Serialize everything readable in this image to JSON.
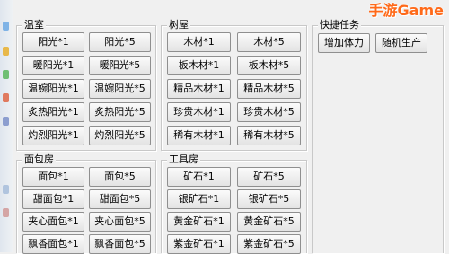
{
  "watermark": "手游Game",
  "groups": {
    "greenhouse": {
      "title": "温室",
      "buttons": [
        "阳光*1",
        "阳光*5",
        "暖阳光*1",
        "暖阳光*5",
        "温婉阳光*1",
        "温婉阳光*5",
        "炙热阳光*1",
        "炙热阳光*5",
        "灼烈阳光*1",
        "灼烈阳光*5"
      ]
    },
    "treehouse": {
      "title": "树屋",
      "buttons": [
        "木材*1",
        "木材*5",
        "板木材*1",
        "板木材*5",
        "精品木材*1",
        "精品木材*5",
        "珍贵木材*1",
        "珍贵木材*5",
        "稀有木材*1",
        "稀有木材*5"
      ]
    },
    "quick": {
      "title": "快捷任务",
      "buttons": [
        "增加体力",
        "随机生产"
      ]
    },
    "bakery": {
      "title": "面包房",
      "buttons": [
        "面包*1",
        "面包*5",
        "甜面包*1",
        "甜面包*5",
        "夹心面包*1",
        "夹心面包*5",
        "飘香面包*1",
        "飘香面包*5"
      ]
    },
    "workshop": {
      "title": "工具房",
      "buttons": [
        "矿石*1",
        "矿石*5",
        "银矿石*1",
        "银矿石*5",
        "黄金矿石*1",
        "黄金矿石*5",
        "紫金矿石*1",
        "紫金矿石*5"
      ]
    }
  }
}
